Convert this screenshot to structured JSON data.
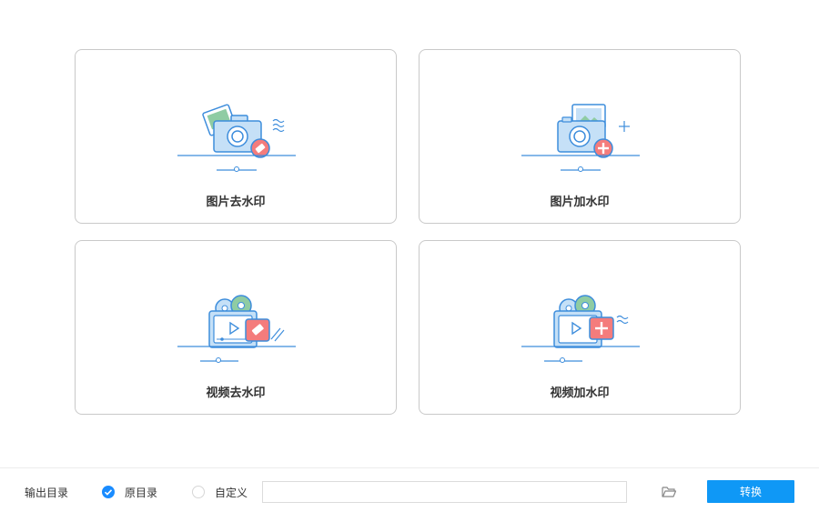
{
  "cards": [
    {
      "label": "图片去水印",
      "icon": "photo-remove-watermark-icon"
    },
    {
      "label": "图片加水印",
      "icon": "photo-add-watermark-icon"
    },
    {
      "label": "视频去水印",
      "icon": "video-remove-watermark-icon"
    },
    {
      "label": "视频加水印",
      "icon": "video-add-watermark-icon"
    }
  ],
  "bottom_bar": {
    "output_label": "输出目录",
    "option_original": "原目录",
    "option_custom": "自定义",
    "selected_option": "原目录",
    "path_value": "",
    "folder_icon": "folder-open-icon",
    "convert_label": "转换"
  },
  "colors": {
    "accent": "#0f98f6",
    "illustration_blue": "#3d8ddc",
    "illustration_light_blue": "#c5e0f7",
    "illustration_red": "#f47c7c",
    "illustration_green": "#8fcca3",
    "card_border": "#c9c9c9"
  }
}
